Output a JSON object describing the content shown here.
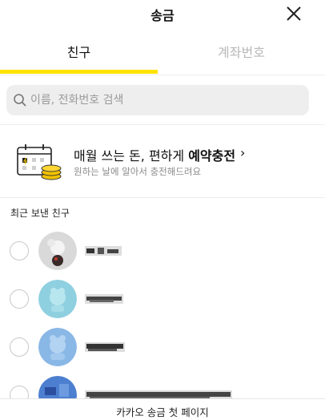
{
  "header": {
    "title": "송금"
  },
  "tabs": [
    {
      "label": "친구",
      "active": true
    },
    {
      "label": "계좌번호",
      "active": false
    }
  ],
  "search": {
    "placeholder": "이름, 전화번호 검색",
    "value": ""
  },
  "banner": {
    "line1_prefix": "매월 쓰는 돈, 편하게 ",
    "line1_bold": "예약충전",
    "chevron": "›",
    "line2": "원하는 날에 알아서 충전해드려요"
  },
  "section": {
    "recent_label": "최근 보낸 친구"
  },
  "friends": [
    {
      "avatar_color": "#d9d9d9",
      "selected": false
    },
    {
      "avatar_color": "#8fd0e0",
      "selected": false
    },
    {
      "avatar_color": "#8ab8e6",
      "selected": false
    },
    {
      "avatar_color": "#4d7fd0",
      "selected": false
    }
  ],
  "footer": {
    "caption": "카카오 송금 첫 페이지"
  },
  "colors": {
    "accent": "#ffe300",
    "inactive_tab": "#b8b8b8",
    "coin": "#f2c200"
  }
}
